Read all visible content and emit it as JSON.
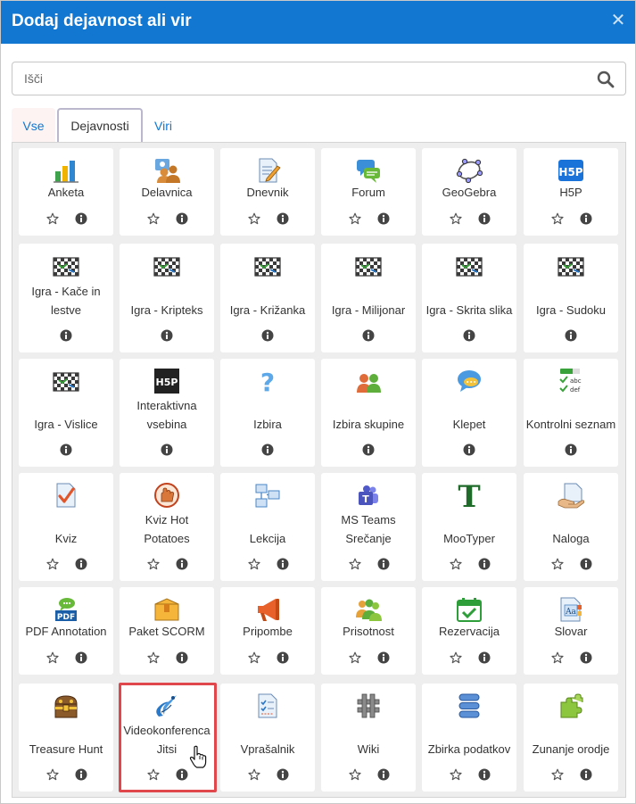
{
  "dialog": {
    "title": "Dodaj dejavnost ali vir"
  },
  "search": {
    "placeholder": "Išči"
  },
  "tabs": [
    {
      "label": "Vse"
    },
    {
      "label": "Dejavnosti",
      "active": true
    },
    {
      "label": "Viri"
    }
  ],
  "colors": {
    "header": "#1177d1",
    "link": "#1177d1",
    "highlight": "#e0474c"
  },
  "rows": [
    [
      {
        "label": "Anketa",
        "icon": "bar-chart-icon",
        "star": true
      },
      {
        "label": "Delavnica",
        "icon": "workshop-icon",
        "star": true
      },
      {
        "label": "Dnevnik",
        "icon": "journal-icon",
        "star": true
      },
      {
        "label": "Forum",
        "icon": "forum-icon",
        "star": true
      },
      {
        "label": "GeoGebra",
        "icon": "geogebra-icon",
        "star": true
      },
      {
        "label": "H5P",
        "icon": "h5p-icon",
        "star": true
      }
    ],
    [
      {
        "label": "Igra - Kače in lestve",
        "icon": "game-board-icon",
        "star": false
      },
      {
        "label": "Igra - Kripteks",
        "icon": "game-board-icon",
        "star": false
      },
      {
        "label": "Igra - Križanka",
        "icon": "game-board-icon",
        "star": false
      },
      {
        "label": "Igra - Milijonar",
        "icon": "game-board-icon",
        "star": false
      },
      {
        "label": "Igra - Skrita slika",
        "icon": "game-board-icon",
        "star": false
      },
      {
        "label": "Igra - Sudoku",
        "icon": "game-board-icon",
        "star": false
      }
    ],
    [
      {
        "label": "Igra - Vislice",
        "icon": "game-board-icon",
        "star": false
      },
      {
        "label": "Interaktivna vsebina",
        "icon": "h5p-dark-icon",
        "star": false
      },
      {
        "label": "Izbira",
        "icon": "question-mark-icon",
        "star": false
      },
      {
        "label": "Izbira skupine",
        "icon": "group-choice-icon",
        "star": false
      },
      {
        "label": "Klepet",
        "icon": "chat-icon",
        "star": false
      },
      {
        "label": "Kontrolni seznam",
        "icon": "checklist-icon",
        "star": false
      }
    ],
    [
      {
        "label": "Kviz",
        "icon": "quiz-icon",
        "star": true
      },
      {
        "label": "Kviz Hot Potatoes",
        "icon": "hot-potatoes-icon",
        "star": true
      },
      {
        "label": "Lekcija",
        "icon": "lesson-icon",
        "star": true
      },
      {
        "label": "MS Teams Srečanje",
        "icon": "teams-icon",
        "star": true
      },
      {
        "label": "MooTyper",
        "icon": "mootyper-icon",
        "star": true
      },
      {
        "label": "Naloga",
        "icon": "assignment-icon",
        "star": true
      }
    ],
    [
      {
        "label": "PDF Annotation",
        "icon": "pdf-annotation-icon",
        "star": true
      },
      {
        "label": "Paket SCORM",
        "icon": "scorm-icon",
        "star": true
      },
      {
        "label": "Pripombe",
        "icon": "megaphone-icon",
        "star": true
      },
      {
        "label": "Prisotnost",
        "icon": "attendance-icon",
        "star": true
      },
      {
        "label": "Rezervacija",
        "icon": "calendar-check-icon",
        "star": true
      },
      {
        "label": "Slovar",
        "icon": "glossary-icon",
        "star": true
      }
    ],
    [
      {
        "label": "Treasure Hunt",
        "icon": "treasure-chest-icon",
        "star": true
      },
      {
        "label": "Videokonferenca Jitsi",
        "icon": "jitsi-icon",
        "star": true
      },
      {
        "label": "Vprašalnik",
        "icon": "questionnaire-icon",
        "star": true
      },
      {
        "label": "Wiki",
        "icon": "wiki-icon",
        "star": true
      },
      {
        "label": "Zbirka podatkov",
        "icon": "database-icon",
        "star": true
      },
      {
        "label": "Zunanje orodje",
        "icon": "puzzle-icon",
        "star": true
      }
    ]
  ]
}
